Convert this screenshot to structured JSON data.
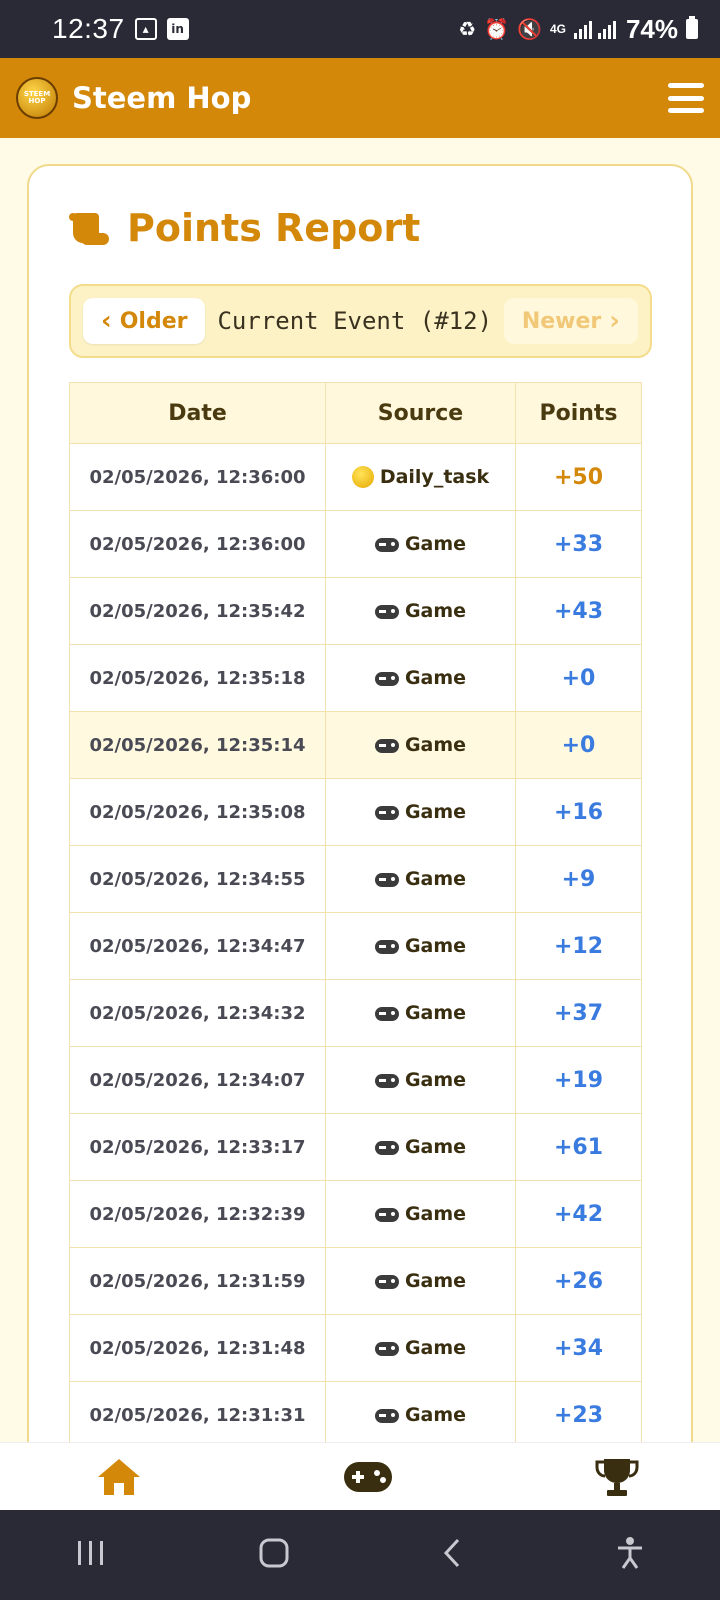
{
  "status_bar": {
    "time": "12:37",
    "network": "4G",
    "battery": "74%"
  },
  "header": {
    "logo_text": "STEEM HOP",
    "title": "Steem Hop"
  },
  "page": {
    "title": "Points Report"
  },
  "event_nav": {
    "older_label": "Older",
    "current_label": "Current Event (#12)",
    "newer_label": "Newer"
  },
  "table": {
    "headers": {
      "date": "Date",
      "source": "Source",
      "points": "Points"
    },
    "rows": [
      {
        "date": "02/05/2026, 12:36:00",
        "source": "Daily_task",
        "points": "+50"
      },
      {
        "date": "02/05/2026, 12:36:00",
        "source": "Game",
        "points": "+33"
      },
      {
        "date": "02/05/2026, 12:35:42",
        "source": "Game",
        "points": "+43"
      },
      {
        "date": "02/05/2026, 12:35:18",
        "source": "Game",
        "points": "+0"
      },
      {
        "date": "02/05/2026, 12:35:14",
        "source": "Game",
        "points": "+0"
      },
      {
        "date": "02/05/2026, 12:35:08",
        "source": "Game",
        "points": "+16"
      },
      {
        "date": "02/05/2026, 12:34:55",
        "source": "Game",
        "points": "+9"
      },
      {
        "date": "02/05/2026, 12:34:47",
        "source": "Game",
        "points": "+12"
      },
      {
        "date": "02/05/2026, 12:34:32",
        "source": "Game",
        "points": "+37"
      },
      {
        "date": "02/05/2026, 12:34:07",
        "source": "Game",
        "points": "+19"
      },
      {
        "date": "02/05/2026, 12:33:17",
        "source": "Game",
        "points": "+61"
      },
      {
        "date": "02/05/2026, 12:32:39",
        "source": "Game",
        "points": "+42"
      },
      {
        "date": "02/05/2026, 12:31:59",
        "source": "Game",
        "points": "+26"
      },
      {
        "date": "02/05/2026, 12:31:48",
        "source": "Game",
        "points": "+34"
      },
      {
        "date": "02/05/2026, 12:31:31",
        "source": "Game",
        "points": "+23"
      }
    ]
  },
  "colors": {
    "brand": "#d4880a",
    "points_game": "#3a7be0",
    "points_daily": "#d4880a"
  },
  "icons": {
    "status": [
      "image-icon",
      "linkedin-icon",
      "saver-icon",
      "alarm-icon",
      "mute-icon",
      "signal-icon",
      "battery-icon"
    ],
    "bottom_nav": [
      "home-icon",
      "gamepad-icon",
      "trophy-icon"
    ],
    "system_nav": [
      "recents-icon",
      "home-button-icon",
      "back-icon",
      "accessibility-icon"
    ]
  }
}
